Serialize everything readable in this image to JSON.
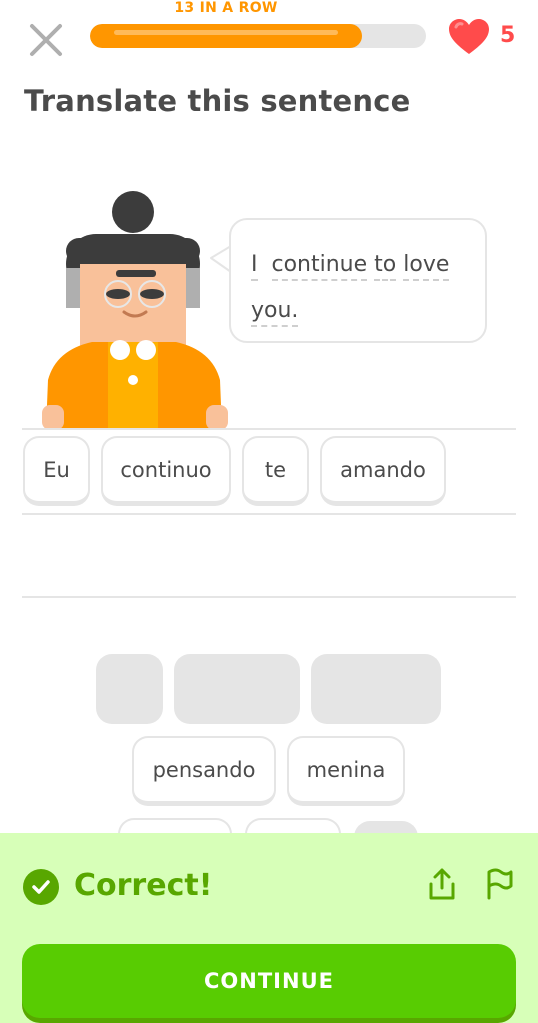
{
  "header": {
    "streak_label": "13 IN A ROW",
    "progress_fraction": 0.81,
    "hearts": "5",
    "colors": {
      "progress": "#ff9600",
      "heart": "#ff4b4b"
    }
  },
  "exercise": {
    "title": "Translate this sentence",
    "prompt_words": [
      "I",
      "continue",
      "to",
      "love",
      "you."
    ]
  },
  "answer": {
    "tiles": [
      "Eu",
      "continuo",
      "te",
      "amando"
    ]
  },
  "bank": {
    "used_slots": 3,
    "tiles": [
      "pensando",
      "menina"
    ]
  },
  "feedback": {
    "status": "Correct!",
    "continue_label": "CONTINUE",
    "colors": {
      "background": "#d7ffb8",
      "accent": "#58a700",
      "button": "#58cc02"
    }
  }
}
